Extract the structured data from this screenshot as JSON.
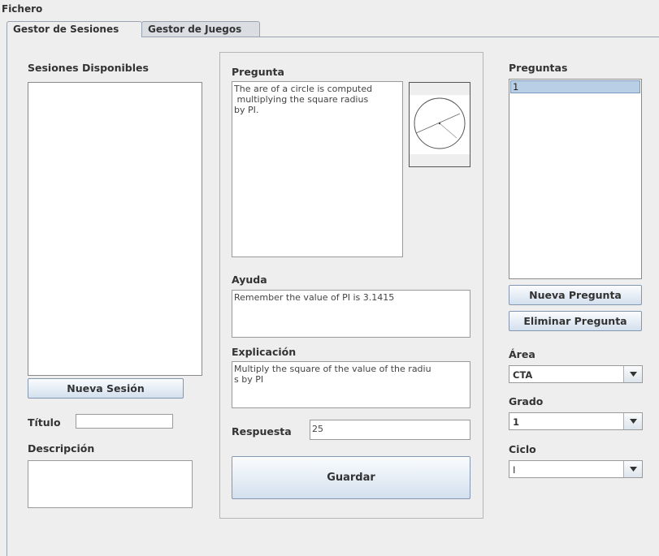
{
  "menubar": {
    "file_menu": "Fichero"
  },
  "tabs": [
    {
      "label": "Gestor de Sesiones"
    },
    {
      "label": "Gestor de Juegos"
    }
  ],
  "sessions": {
    "title": "Sesiones Disponibles",
    "new_button": "Nueva Sesión",
    "titulo_label": "Título",
    "titulo_value": "",
    "descripcion_label": "Descripción",
    "descripcion_value": ""
  },
  "question_editor": {
    "pregunta_label": "Pregunta",
    "pregunta_text": "The are of a circle is computed\n multiplying the square radius\nby PI.",
    "image_icon": "circle-diagram-icon",
    "ayuda_label": "Ayuda",
    "ayuda_text": "Remember the value of PI is 3.1415",
    "explicacion_label": "Explicación",
    "explicacion_text": "Multiply the square of the value of the radiu\ns by PI",
    "respuesta_label": "Respuesta",
    "respuesta_value": "25",
    "save_button": "Guardar"
  },
  "questions": {
    "title": "Preguntas",
    "items": [
      "1"
    ],
    "new_button": "Nueva Pregunta",
    "delete_button": "Eliminar Pregunta",
    "area_label": "Área",
    "area_value": "CTA",
    "grado_label": "Grado",
    "grado_value": "1",
    "ciclo_label": "Ciclo",
    "ciclo_value": "I"
  },
  "colors": {
    "selection": "#b8cfe5",
    "button_top": "#fafcfe",
    "button_bottom": "#d4e0ee"
  }
}
